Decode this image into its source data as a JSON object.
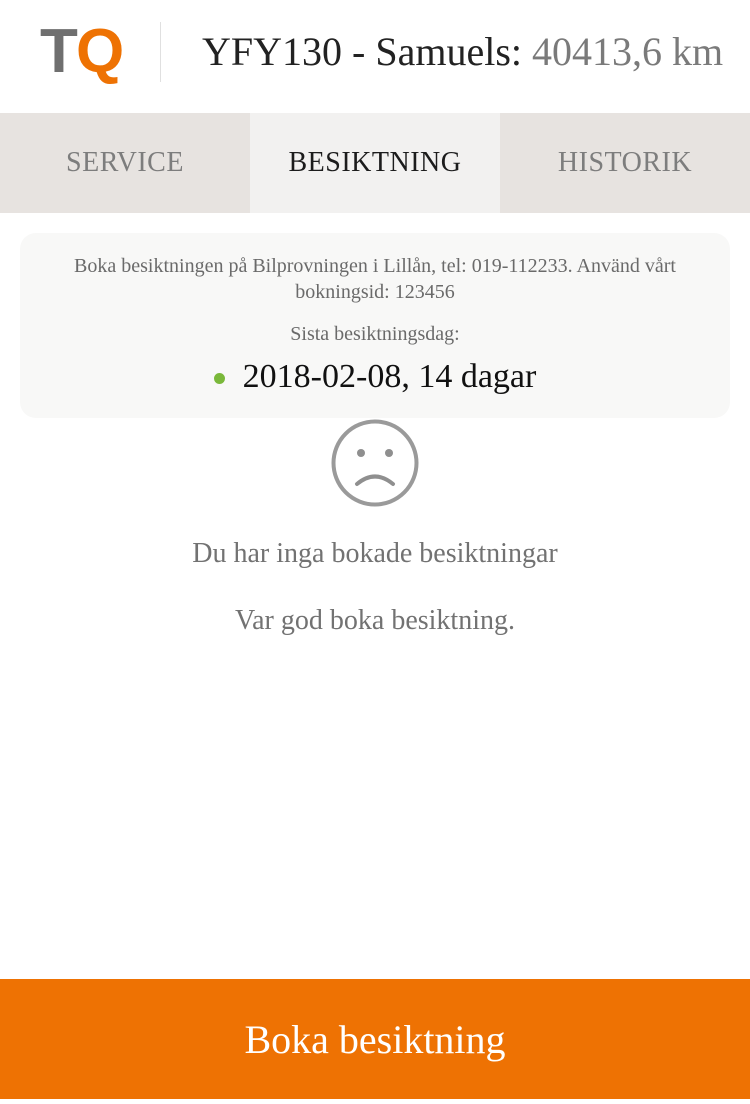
{
  "header": {
    "logo_t": "T",
    "logo_q": "Q",
    "vehicle": "YFY130 - Samuels: ",
    "mileage": "40413,6 km"
  },
  "tabs": [
    {
      "label": "SERVICE",
      "active": false
    },
    {
      "label": "BESIKTNING",
      "active": true
    },
    {
      "label": "HISTORIK",
      "active": false
    }
  ],
  "info": {
    "text": "Boka besiktningen på Bilprovningen i Lillån, tel: 019-112233. Använd vårt bokningsid: 123456",
    "label": "Sista besiktningsdag:",
    "date": "2018-02-08, 14 dagar",
    "status_color": "#7ab83a"
  },
  "empty": {
    "icon": "sad-face-icon",
    "message": "Du har inga bokade besiktningar",
    "sub": "Var god boka besiktning."
  },
  "cta": {
    "label": "Boka besiktning"
  },
  "colors": {
    "accent": "#ee7203",
    "logo_gray": "#6f6f6f",
    "tab_bg": "#e7e3e0",
    "tab_active_bg": "#f2f1f0"
  }
}
